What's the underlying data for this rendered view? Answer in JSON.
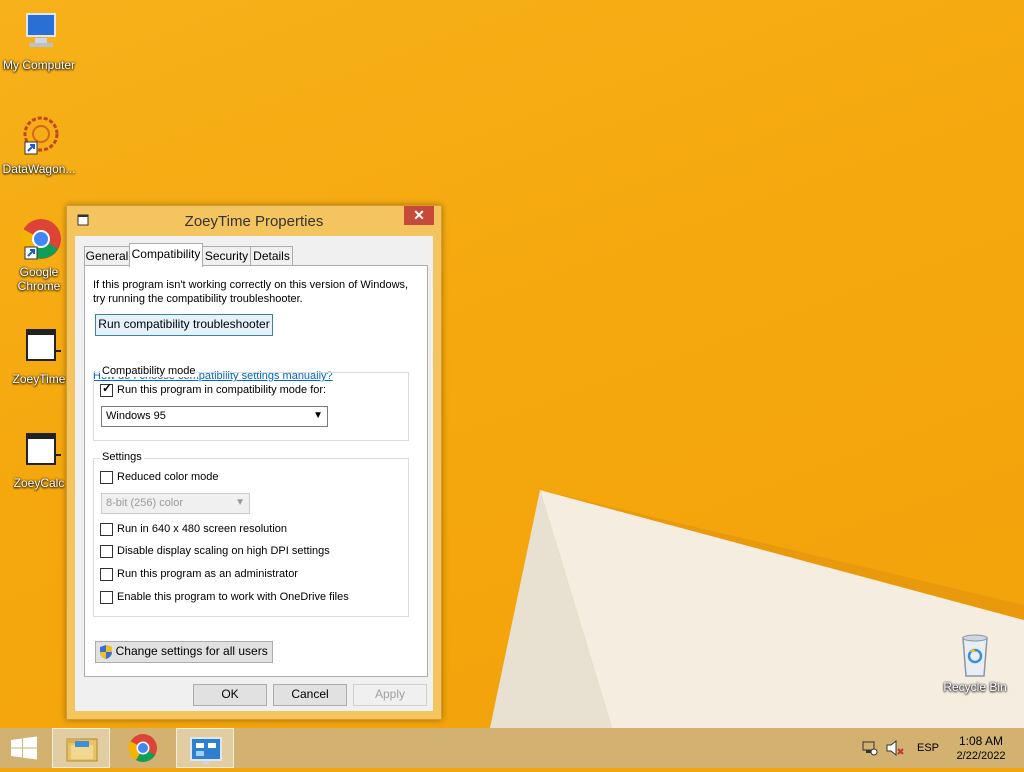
{
  "desktop": {
    "icons": [
      {
        "label": "My Computer",
        "icon": "computer-icon"
      },
      {
        "label": "DataWagon...",
        "icon": "datawagon-icon"
      },
      {
        "label": "Google\nChrome",
        "label_line1": "Google",
        "label_line2": "Chrome",
        "icon": "chrome-icon"
      },
      {
        "label": "ZoeyTime",
        "icon": "app-window-icon"
      },
      {
        "label": "ZoeyCalc",
        "icon": "app-window-icon"
      },
      {
        "label": "Recycle Bin",
        "icon": "recycle-bin-icon"
      }
    ]
  },
  "window": {
    "title": "ZoeyTime Properties",
    "close_label": "✕",
    "tabs": [
      {
        "label": "General",
        "active": false
      },
      {
        "label": "Compatibility",
        "active": true
      },
      {
        "label": "Security",
        "active": false
      },
      {
        "label": "Details",
        "active": false
      }
    ],
    "intro_line1": "If this program isn't working correctly on this version of Windows,",
    "intro_line2": "try running the compatibility troubleshooter.",
    "troubleshooter_button": "Run compatibility troubleshooter",
    "help_link": "How do I choose compatibility settings manually?",
    "compat_group": {
      "legend": "Compatibility mode",
      "checkbox_label": "Run this program in compatibility mode for:",
      "checked": true,
      "selected_os": "Windows 95"
    },
    "settings_group": {
      "legend": "Settings",
      "reduced_color": {
        "label": "Reduced color mode",
        "checked": false
      },
      "color_select": "8-bit (256) color",
      "res640": {
        "label": "Run in 640 x 480 screen resolution",
        "checked": false
      },
      "dpi": {
        "label": "Disable display scaling on high DPI settings",
        "checked": false
      },
      "admin": {
        "label": "Run this program as an administrator",
        "checked": false
      },
      "onedrive": {
        "label": "Enable this program to work with OneDrive files",
        "checked": false
      }
    },
    "change_all_button": "Change settings for all users",
    "ok": "OK",
    "cancel": "Cancel",
    "apply": "Apply"
  },
  "taskbar": {
    "language": "ESP",
    "time": "1:08 AM",
    "date": "2/22/2022"
  },
  "colors": {
    "desktop": "#f5a80e",
    "window_frame": "#f4c55e",
    "close_button": "#c7493a",
    "taskbar": "#d3b171",
    "link": "#0066cc"
  }
}
